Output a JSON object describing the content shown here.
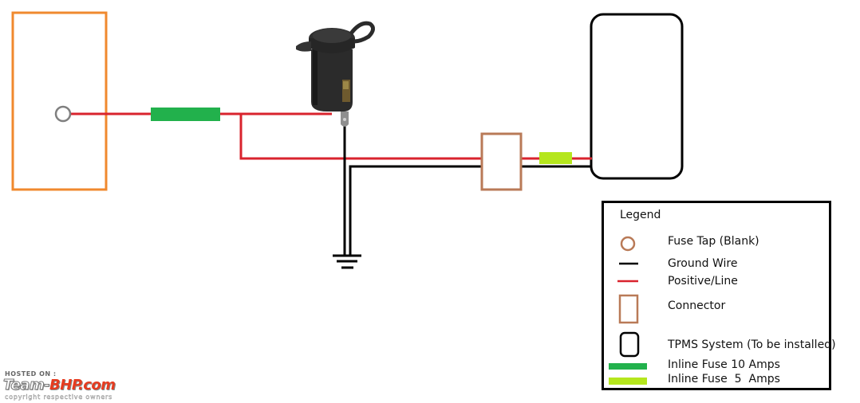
{
  "colors": {
    "positive_wire": "#d9232d",
    "ground_wire": "#000000",
    "fuse_box_outline": "#f0892e",
    "fuse_tap": "#7f7f7f",
    "connector": "#b97a57",
    "tpms_outline": "#000000",
    "fuse_10a": "#22b14c",
    "fuse_5a": "#b5e61d"
  },
  "components": {
    "fuse_box": "Fuse Box",
    "fuse_tap": "Fuse Tap",
    "inline_fuse_10a": "Inline Fuse 10 Amps",
    "socket": "12V Power Socket",
    "ground": "Ground",
    "connector": "Connector",
    "inline_fuse_5a": "Inline Fuse 5 Amps",
    "tpms": "TPMS System"
  },
  "legend": {
    "title": "Legend",
    "items": [
      {
        "symbol": "fuse-tap",
        "label": "Fuse Tap (Blank)"
      },
      {
        "symbol": "ground-wire",
        "label": "Ground Wire"
      },
      {
        "symbol": "positive-wire",
        "label": "Positive/Line"
      },
      {
        "symbol": "connector",
        "label": "Connector"
      },
      {
        "symbol": "tpms",
        "label": "TPMS System (To be installed)"
      },
      {
        "symbol": "fuse-10a",
        "label": "Inline Fuse 10 Amps"
      },
      {
        "symbol": "fuse-5a",
        "label": "Inline Fuse  5  Amps"
      }
    ]
  },
  "watermark": {
    "hosted": "HOSTED ON :",
    "brand_a": "Team-",
    "brand_b": "BHP.com",
    "copyright": "copyright respective owners"
  }
}
